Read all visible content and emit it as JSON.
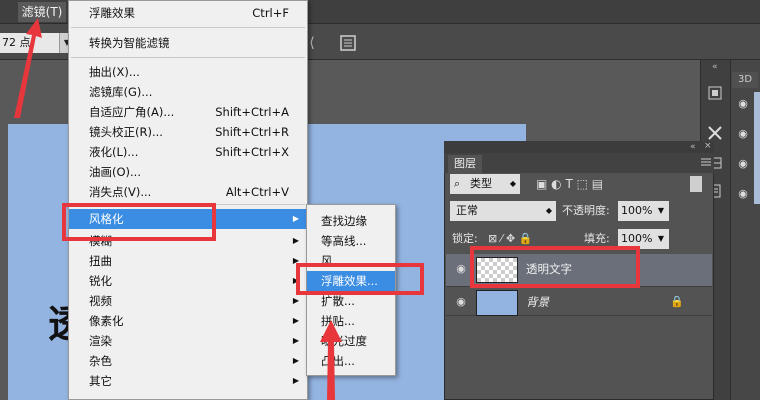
{
  "menubar": {
    "filter_label": "滤镜(T)"
  },
  "options_bar": {
    "font_size": "72 点"
  },
  "filter_menu": {
    "items": [
      {
        "label": "浮雕效果",
        "shortcut": "Ctrl+F"
      },
      {
        "label": "转换为智能滤镜",
        "shortcut": ""
      },
      {
        "label": "抽出(X)...",
        "shortcut": ""
      },
      {
        "label": "滤镜库(G)...",
        "shortcut": ""
      },
      {
        "label": "自适应广角(A)...",
        "shortcut": "Shift+Ctrl+A"
      },
      {
        "label": "镜头校正(R)...",
        "shortcut": "Shift+Ctrl+R"
      },
      {
        "label": "液化(L)...",
        "shortcut": "Shift+Ctrl+X"
      },
      {
        "label": "油画(O)...",
        "shortcut": ""
      },
      {
        "label": "消失点(V)...",
        "shortcut": "Alt+Ctrl+V"
      },
      {
        "label": "风格化",
        "shortcut": ""
      },
      {
        "label": "模糊",
        "shortcut": ""
      },
      {
        "label": "扭曲",
        "shortcut": ""
      },
      {
        "label": "锐化",
        "shortcut": ""
      },
      {
        "label": "视频",
        "shortcut": ""
      },
      {
        "label": "像素化",
        "shortcut": ""
      },
      {
        "label": "渲染",
        "shortcut": ""
      },
      {
        "label": "杂色",
        "shortcut": ""
      },
      {
        "label": "其它",
        "shortcut": ""
      }
    ]
  },
  "stylize_submenu": {
    "items": [
      {
        "label": "查找边缘"
      },
      {
        "label": "等高线..."
      },
      {
        "label": "风..."
      },
      {
        "label": "浮雕效果..."
      },
      {
        "label": "扩散..."
      },
      {
        "label": "拼贴..."
      },
      {
        "label": "曝光过度"
      },
      {
        "label": "凸出..."
      }
    ]
  },
  "dock": {
    "tab_3d": "3D"
  },
  "layers_panel": {
    "tab_label": "图层",
    "kind_label": "类型",
    "blend_mode": "正常",
    "opacity_label": "不透明度:",
    "opacity_value": "100%",
    "lock_label": "锁定:",
    "fill_label": "填充:",
    "fill_value": "100%",
    "layers": [
      {
        "name": "透明文字"
      },
      {
        "name": "背景"
      }
    ]
  },
  "colors": {
    "highlight": "#3a8de3",
    "annotation_red": "#e8373c",
    "document_blue": "#93b3e0"
  }
}
